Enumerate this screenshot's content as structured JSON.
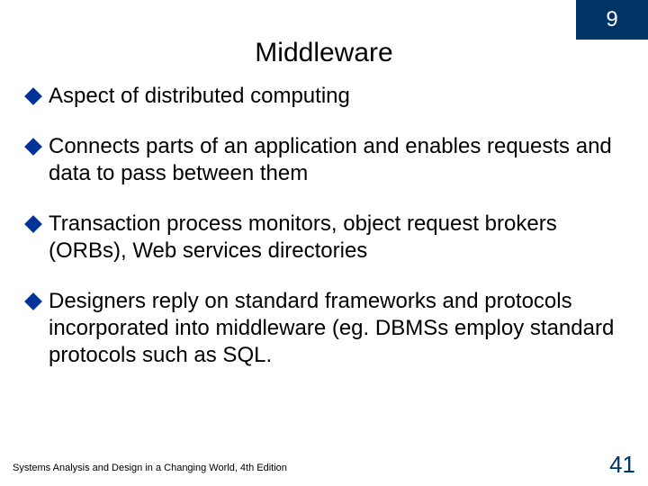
{
  "chapter": "9",
  "title": "Middleware",
  "bullets": [
    "Aspect of distributed computing",
    "Connects parts of an application and enables requests and data to pass between them",
    "Transaction process monitors, object request brokers (ORBs), Web services directories",
    "Designers reply on standard frameworks and protocols incorporated into middleware (eg. DBMSs employ standard protocols such as SQL."
  ],
  "footer": {
    "left": "Systems Analysis and Design in a Changing World, 4th Edition",
    "page": "41"
  }
}
